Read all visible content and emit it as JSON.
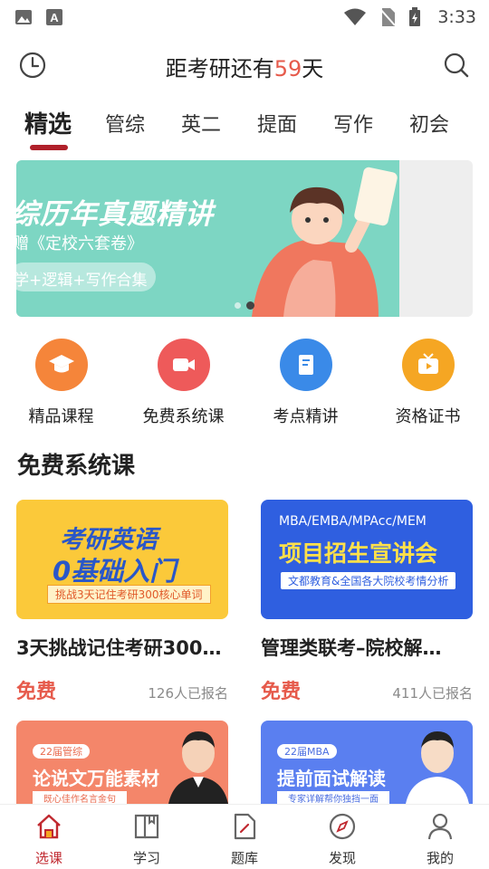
{
  "status_bar": {
    "time": "3:33"
  },
  "header": {
    "title_prefix": "距考研还有",
    "days": "59",
    "title_suffix": "天"
  },
  "tabs": [
    {
      "label": "精选",
      "active": true
    },
    {
      "label": "管综"
    },
    {
      "label": "英二"
    },
    {
      "label": "提面"
    },
    {
      "label": "写作"
    },
    {
      "label": "初会"
    }
  ],
  "banner": {
    "title": "综历年真题精讲",
    "subtitle": "赠《定校六套卷》",
    "pill": "学+逻辑+写作合集",
    "bg_color": "#7dd6c3"
  },
  "quick_links": [
    {
      "label": "精品课程",
      "icon": "graduation-cap-icon",
      "color": "#f5853a"
    },
    {
      "label": "免费系统课",
      "icon": "video-camera-icon",
      "color": "#ee5a5a"
    },
    {
      "label": "考点精讲",
      "icon": "document-icon",
      "color": "#3a8ae8"
    },
    {
      "label": "资格证书",
      "icon": "tv-icon",
      "color": "#f5a623"
    }
  ],
  "section": {
    "title": "免费系统课"
  },
  "courses": [
    {
      "title": "3天挑战记住考研300…",
      "price": "免费",
      "enrolled": "126人已报名",
      "thumb_line1": "考研英语",
      "thumb_line2": "0基础入门",
      "thumb_strip": "挑战3天记住考研300核心单词"
    },
    {
      "title": "管理类联考–院校解…",
      "price": "免费",
      "enrolled": "411人已报名",
      "thumb_top": "MBA/EMBA/MPAcc/MEM",
      "thumb_line1": "项目招生宣讲会",
      "thumb_strip": "文都教育&全国各大院校考情分析"
    },
    {
      "thumb_badge": "22届管综",
      "thumb_line1": "论说文万能素材",
      "thumb_strip": "既心佳作名言金句"
    },
    {
      "thumb_badge": "22届MBA",
      "thumb_line1": "提前面试解读",
      "thumb_strip": "专家详解帮你独挡一面"
    }
  ],
  "tabbar": [
    {
      "label": "选课",
      "icon": "home-icon",
      "active": true
    },
    {
      "label": "学习",
      "icon": "book-icon"
    },
    {
      "label": "题库",
      "icon": "edit-doc-icon"
    },
    {
      "label": "发现",
      "icon": "compass-icon"
    },
    {
      "label": "我的",
      "icon": "user-icon"
    }
  ]
}
